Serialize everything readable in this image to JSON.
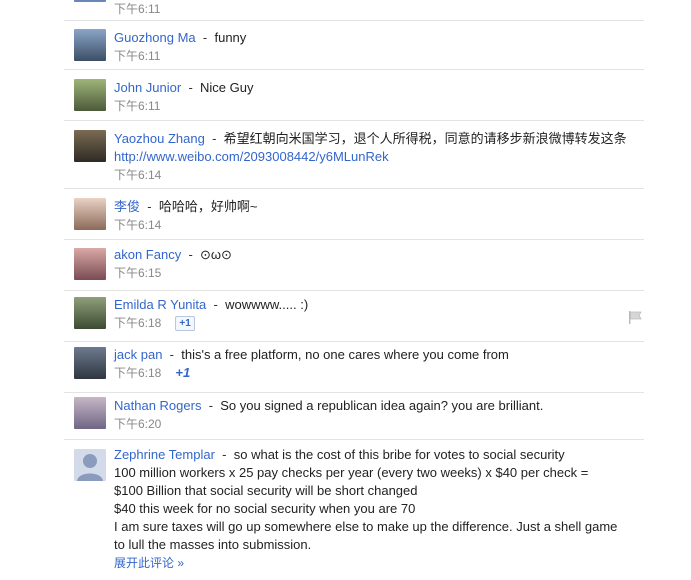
{
  "top_time": "下午6:11",
  "expand_label": "展开此评论 »",
  "comments": [
    {
      "author": "Guozhong Ma",
      "text": "funny",
      "time": "下午6:11"
    },
    {
      "author": "John Junior",
      "text": "Nice Guy",
      "time": "下午6:11"
    },
    {
      "author": "Yaozhou Zhang",
      "text": "希望红朝向米国学习，退个人所得税，同意的请移步新浪微博转发这条",
      "link": "http://www.weibo.com/2093008442/y6MLunRek",
      "time": "下午6:14"
    },
    {
      "author": "李俊",
      "text": "哈哈哈，好帅啊~",
      "time": "下午6:14"
    },
    {
      "author": "akon Fancy",
      "text": "⊙ω⊙",
      "time": "下午6:15"
    },
    {
      "author": "Emilda R Yunita",
      "text": "wowwww..... :)",
      "time": "下午6:18",
      "plus": "+1"
    },
    {
      "author": "jack pan",
      "text": "this's a free platform, no one cares where you come from",
      "time": "下午6:18",
      "plus": "+1"
    },
    {
      "author": "Nathan Rogers",
      "text": "So you signed a republican idea again? you are brilliant.",
      "time": "下午6:20"
    },
    {
      "author": "Zephrine Templar",
      "text": "so what is the cost of this bribe for votes to social security",
      "lines": [
        "100 million workers x 25 pay checks per year (every two weeks) x $40 per check =",
        "$100 Billion that social security will be short changed",
        "$40 this week for no social security when you are 70",
        "I am sure taxes will go up somewhere else to make up the difference. Just a shell game",
        "to lull the masses into submission."
      ]
    }
  ]
}
